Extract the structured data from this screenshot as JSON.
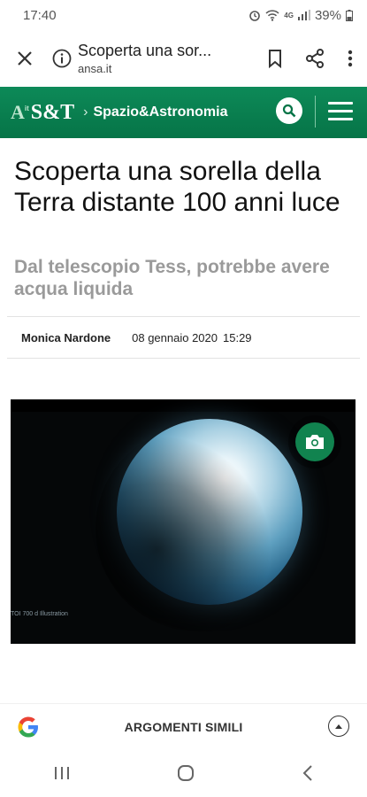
{
  "status_bar": {
    "time": "17:40",
    "network": "4G",
    "battery": "39%"
  },
  "browser": {
    "page_title": "Scoperta una sor...",
    "domain": "ansa.it"
  },
  "site": {
    "logo_a": "A",
    "logo_sub": "it",
    "logo_brand": "S&T",
    "section": "Spazio&Astronomia"
  },
  "article": {
    "headline": "Scoperta una sorella della Terra distante 100 anni luce",
    "subheadline": "Dal telescopio Tess, potrebbe avere acqua liquida",
    "author": "Monica Nardone",
    "date": "08 gennaio 2020",
    "time": "15:29",
    "image_caption": "TOI 700 d Illustration"
  },
  "related_bar": {
    "label": "ARGOMENTI SIMILI"
  },
  "colors": {
    "brand_green": "#067447",
    "accent_green": "#11834f"
  },
  "icons": [
    "close-icon",
    "info-icon",
    "bookmark-icon",
    "share-icon",
    "more-vert-icon",
    "search-icon",
    "hamburger-menu-icon",
    "camera-icon",
    "google-icon",
    "chevron-up-icon",
    "recent-apps-icon",
    "home-icon",
    "back-icon"
  ]
}
